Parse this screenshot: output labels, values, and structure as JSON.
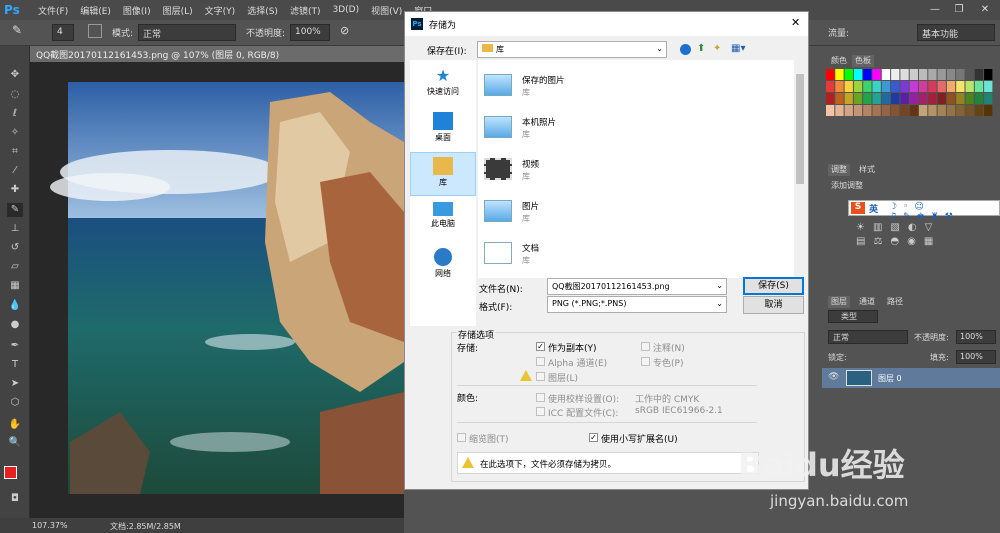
{
  "app": {
    "logo": "Ps"
  },
  "menu": [
    "文件(F)",
    "编辑(E)",
    "图像(I)",
    "图层(L)",
    "文字(Y)",
    "选择(S)",
    "滤镜(T)",
    "3D(D)",
    "视图(V)",
    "窗口"
  ],
  "options": {
    "brush_size": "4",
    "mode_label": "模式:",
    "mode_value": "正常",
    "opacity_label": "不透明度:",
    "opacity_value": "100%",
    "flow_label": "流量:",
    "workspace": "基本功能"
  },
  "document": {
    "tab_title": "QQ截图20170112161453.png @ 107% (图层 0, RGB/8)",
    "zoom": "107.37%",
    "doc_size": "文档:2.85M/2.85M"
  },
  "panels": {
    "color_tabs": [
      "颜色",
      "色板"
    ],
    "adjust_tabs": [
      "调整",
      "样式"
    ],
    "adjust_title": "添加调整",
    "ime_label": "英",
    "layers_tabs": [
      "图层",
      "通道",
      "路径"
    ],
    "filter_label": "类型",
    "blend_mode": "正常",
    "opacity_label": "不透明度:",
    "opacity_value": "100%",
    "lock_label": "锁定:",
    "fill_label": "填充:",
    "fill_value": "100%",
    "layer_name": "图层 0"
  },
  "dialog": {
    "title": "存储为",
    "save_in_label": "保存在(I):",
    "save_in_value": "库",
    "places": [
      "快速访问",
      "桌面",
      "库",
      "此电脑",
      "网络"
    ],
    "files": [
      {
        "name": "保存的图片",
        "type": "库"
      },
      {
        "name": "本机照片",
        "type": "库"
      },
      {
        "name": "视频",
        "type": "库"
      },
      {
        "name": "图片",
        "type": "库"
      },
      {
        "name": "文档",
        "type": "库"
      }
    ],
    "filename_label": "文件名(N):",
    "filename_value": "QQ截图20170112161453.png",
    "format_label": "格式(F):",
    "format_value": "PNG (*.PNG;*.PNS)",
    "save_button": "保存(S)",
    "cancel_button": "取消",
    "options_title": "存储选项",
    "store_label": "存储:",
    "as_copy": "作为副本(Y)",
    "notes": "注释(N)",
    "alpha": "Alpha 通道(E)",
    "spot": "专色(P)",
    "layers": "图层(L)",
    "color_label": "颜色:",
    "proof": "使用校样设置(O):",
    "proof_value": "工作中的 CMYK",
    "icc": "ICC 配置文件(C):",
    "icc_value": "sRGB IEC61966-2.1",
    "thumbnail": "缩览图(T)",
    "lowercase_ext": "使用小写扩展名(U)",
    "warning": "在此选项下，文件必须存储为拷贝。"
  },
  "watermark": {
    "brand": "Baidu经验",
    "url": "jingyan.baidu.com"
  },
  "colors": {
    "accent_red": "#e81f1f",
    "ps_blue": "#31a8ff",
    "highlight": "#cce8ff"
  }
}
